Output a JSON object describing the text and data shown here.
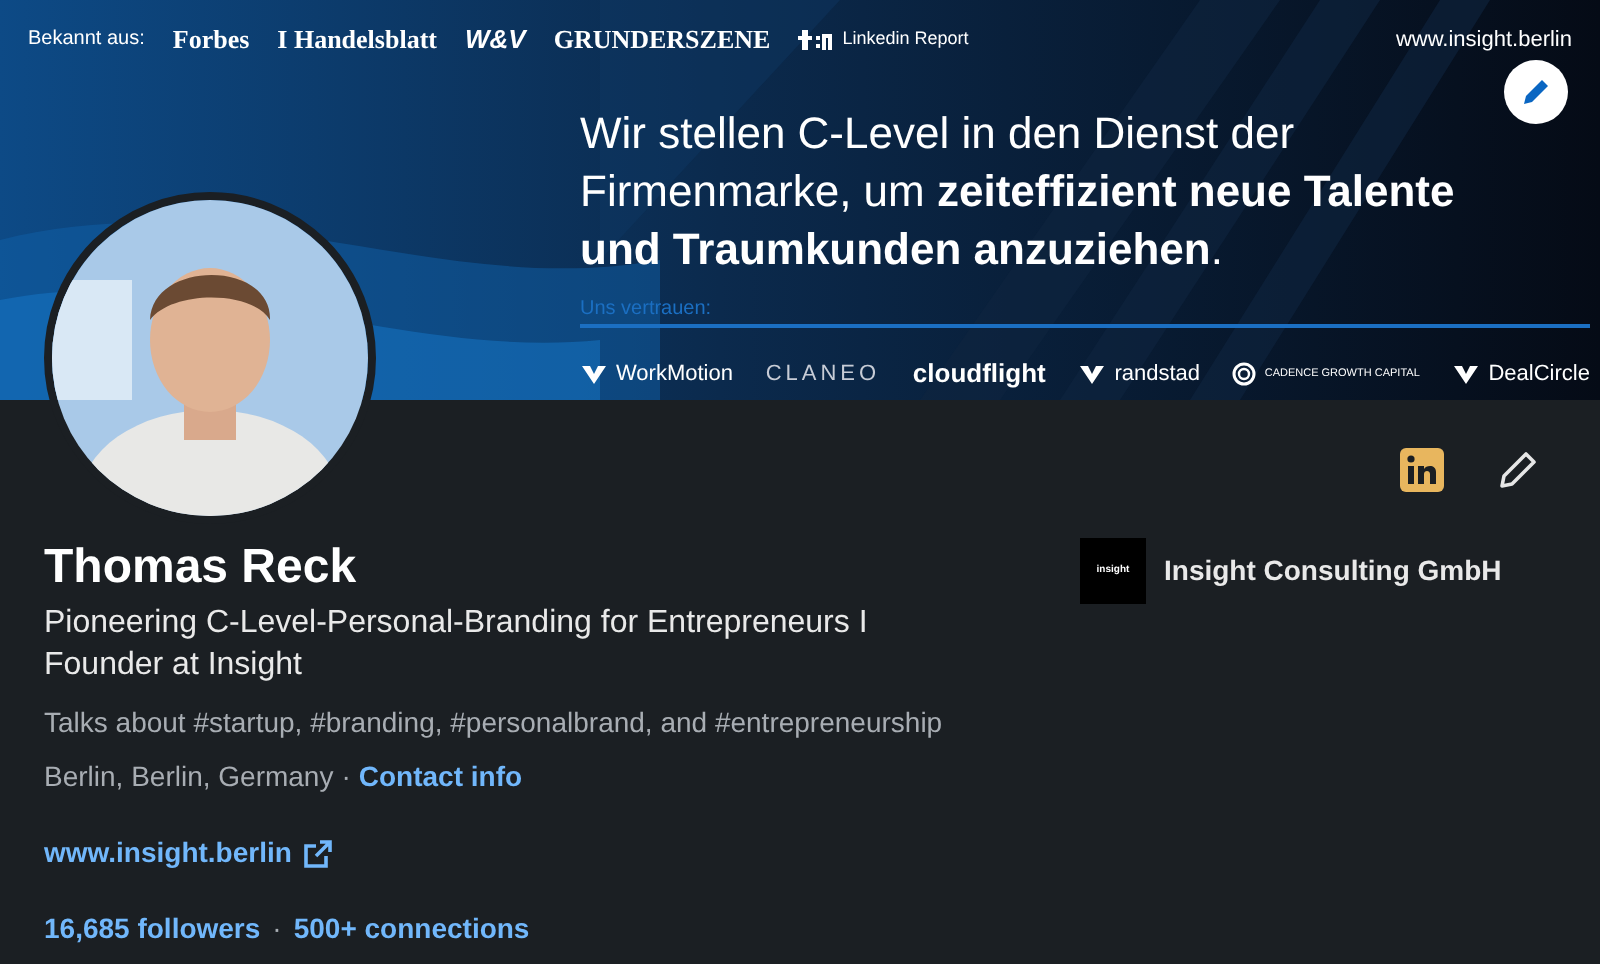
{
  "banner": {
    "known_from_label": "Bekannt aus:",
    "press": [
      {
        "kind": "serif",
        "text": "Forbes"
      },
      {
        "kind": "serif",
        "text": "I Handelsblatt"
      },
      {
        "kind": "heavy",
        "text": "W&V"
      },
      {
        "kind": "serif",
        "text": "GRUNDERSZENE"
      },
      {
        "kind": "t3n",
        "text": "Linkedin Report"
      }
    ],
    "website": "www.insight.berlin",
    "headline": "Wir stellen C-Level in den Dienst der Firmenmarke, um **zeiteffizient neue Talente und Traumkunden anzuziehen**.",
    "trust_label": "Uns vertrauen:",
    "clients": [
      {
        "kind": "icon",
        "text": "WorkMotion"
      },
      {
        "kind": "thin",
        "text": "CLANEO"
      },
      {
        "kind": "bold",
        "text": "cloudflight"
      },
      {
        "kind": "icon",
        "text": "randstad"
      },
      {
        "kind": "small",
        "text": "CADENCE GROWTH CAPITAL"
      },
      {
        "kind": "icon",
        "text": "DealCircle"
      }
    ]
  },
  "profile": {
    "name": "Thomas Reck",
    "headline": "Pioneering C-Level-Personal-Branding for Entrepreneurs I Founder at Insight",
    "talks_about": "Talks about #startup, #branding, #personalbrand, and #entrepreneurship",
    "location": "Berlin, Berlin, Germany",
    "separator": "·",
    "contact_link": "Contact info",
    "website": "www.insight.berlin",
    "followers": "16,685 followers",
    "connections": "500+ connections"
  },
  "company": {
    "logo_text": "insight",
    "name": "Insight Consulting GmbH"
  }
}
